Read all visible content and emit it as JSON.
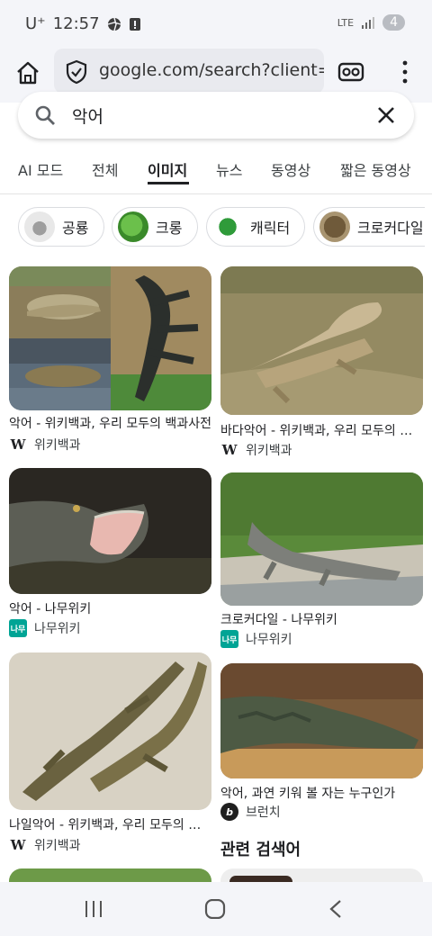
{
  "status_bar": {
    "carrier": "U⁺",
    "time": "12:57",
    "network": "LTE",
    "battery_badge": "4"
  },
  "browser": {
    "url": "google.com/search?client=firefox"
  },
  "search": {
    "query": "악어"
  },
  "tabs": [
    {
      "label": "AI 모드"
    },
    {
      "label": "전체"
    },
    {
      "label": "이미지",
      "active": true
    },
    {
      "label": "뉴스"
    },
    {
      "label": "동영상"
    },
    {
      "label": "짧은 동영상"
    }
  ],
  "chips": [
    {
      "label": "공룡"
    },
    {
      "label": "크롱"
    },
    {
      "label": "캐릭터"
    },
    {
      "label": "크로커다일"
    }
  ],
  "results": [
    {
      "caption": "악어 - 위키백과, 우리 모두의 백과사전",
      "source": "위키백과",
      "favicon": "W"
    },
    {
      "caption": "바다악어 - 위키백과, 우리 모두의 백과사전",
      "source": "위키백과",
      "favicon": "W"
    },
    {
      "caption": "악어 - 나무위키",
      "source": "나무위키",
      "favicon": "namu"
    },
    {
      "caption": "크로커다일 - 나무위키",
      "source": "나무위키",
      "favicon": "namu"
    },
    {
      "caption": "나일악어 - 위키백과, 우리 모두의 백과사전",
      "source": "위키백과",
      "favicon": "W"
    },
    {
      "caption": "악어, 과연 키워 볼 자는 누구인가",
      "source": "브런치",
      "favicon": "b"
    }
  ],
  "related": {
    "heading": "관련 검색어"
  },
  "colors": {
    "toolbar_bg": "#f4f5f9",
    "accent": "#202124",
    "namu_green": "#00a495"
  }
}
